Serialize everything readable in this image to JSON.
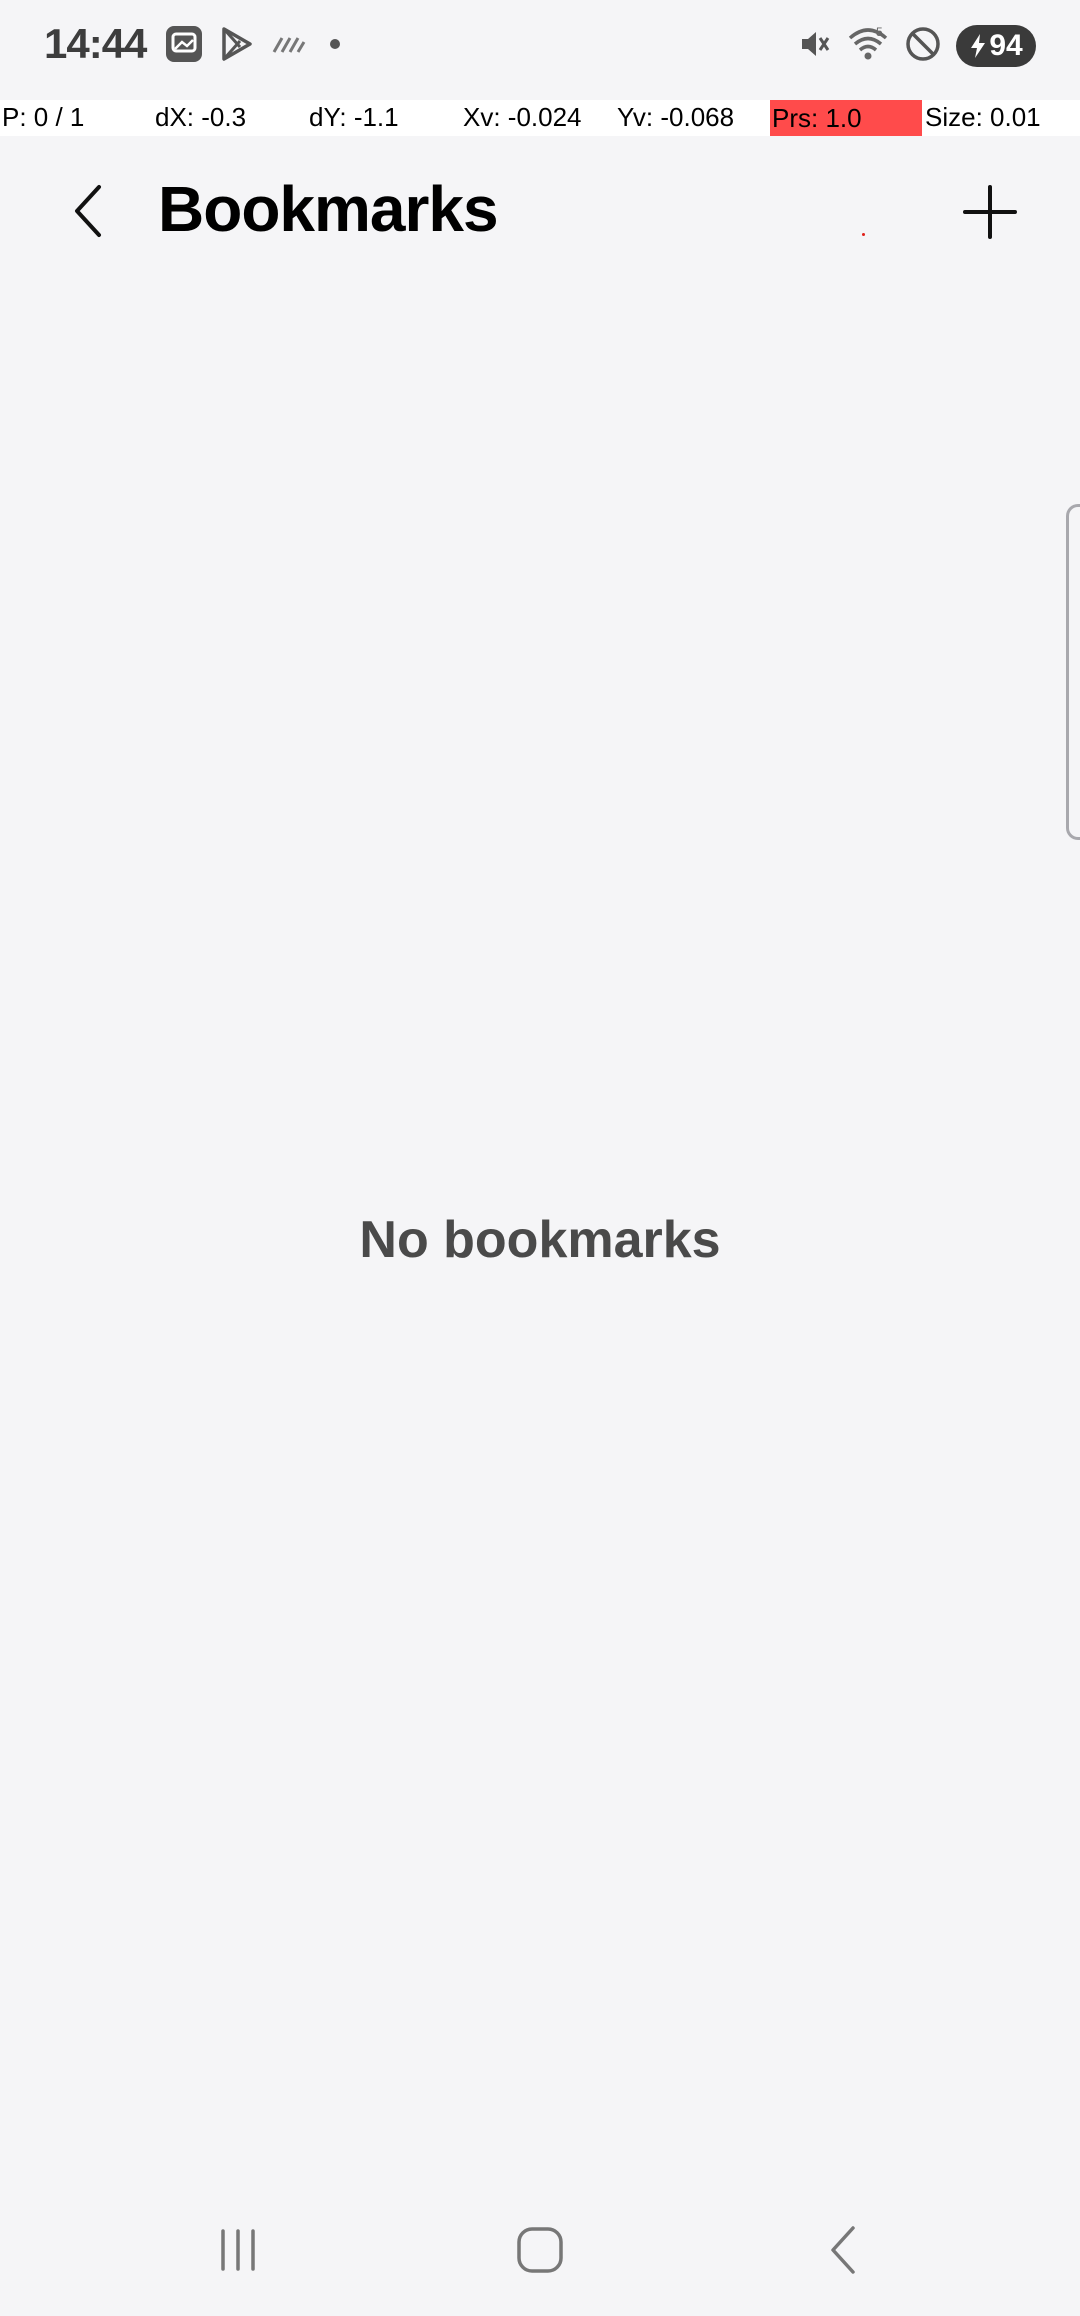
{
  "status_bar": {
    "time": "14:44",
    "battery_level": "94",
    "left_icons": [
      "gallery-app-icon",
      "play-store-icon",
      "data-saver-icon",
      "notification-dot-icon"
    ],
    "right_icons": [
      "mute-icon",
      "wifi-icon",
      "do-not-disturb-icon",
      "battery-charging-icon"
    ]
  },
  "pointer_overlay": {
    "p": "P: 0 / 1",
    "dx": "dX: -0.3",
    "dy": "dY: -1.1",
    "xv": "Xv: -0.024",
    "yv": "Yv: -0.068",
    "prs": "Prs: 1.0",
    "size": "Size: 0.01",
    "prs_color": "#ff4b4b"
  },
  "app_bar": {
    "title": "Bookmarks",
    "back_icon": "chevron-left-icon",
    "add_icon": "plus-icon"
  },
  "content": {
    "empty_message": "No bookmarks"
  },
  "nav_bar": {
    "items": [
      "recent-apps-icon",
      "home-icon",
      "back-icon"
    ]
  },
  "colors": {
    "background": "#f5f5f7",
    "title": "#000000",
    "empty_text": "#4a4a4a"
  }
}
